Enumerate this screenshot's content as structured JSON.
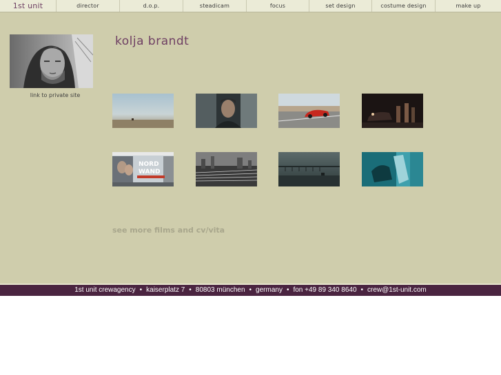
{
  "nav": {
    "logo": "1st unit",
    "items": [
      "director",
      "d.o.p.",
      "steadicam",
      "focus",
      "set design",
      "costume design",
      "make up"
    ]
  },
  "profile": {
    "name": "kolja brandt",
    "private_link": "link to private site"
  },
  "thumbnail_poster_text": "NORD WAND",
  "see_more": "see more films and cv/vita",
  "footer": {
    "company": "1st unit crewagency",
    "street": "kaiserplatz 7",
    "city": "80803 münchen",
    "country": "germany",
    "phone": "fon +49 89 340 8640",
    "email": "crew@1st-unit.com",
    "separator": "•"
  },
  "colors": {
    "background": "#cfcdac",
    "brand": "#6e3f63",
    "footer_bg": "#4a2440"
  }
}
